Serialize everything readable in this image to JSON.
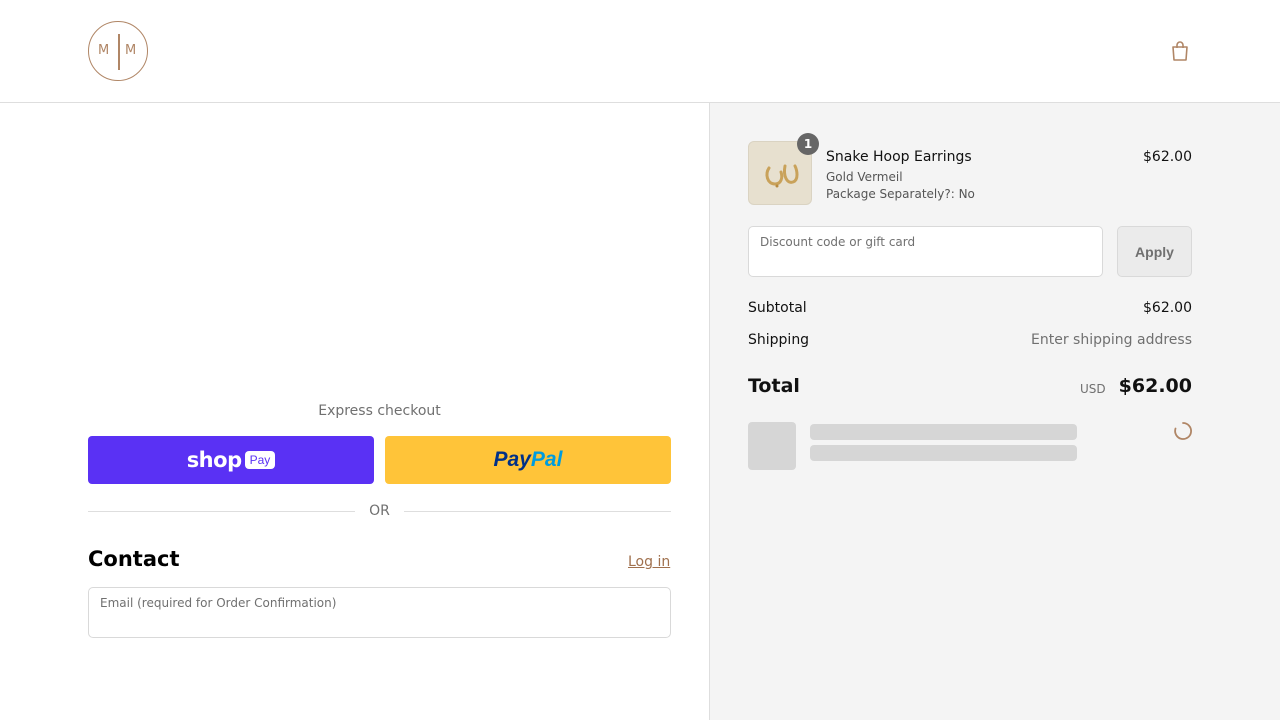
{
  "header": {
    "logo_letters": [
      "M",
      "M"
    ],
    "cart_icon": "shopping-bag-icon",
    "accent": "#b08666"
  },
  "checkout": {
    "express_title": "Express checkout",
    "shop_pay": {
      "word": "shop",
      "badge": "Pay",
      "color": "#5a31f4"
    },
    "paypal": {
      "part1": "Pay",
      "part2": "Pal",
      "color": "#ffc439"
    },
    "divider": "OR",
    "contact": {
      "title": "Contact",
      "login": "Log in",
      "email_placeholder": "Email (required for Order Confirmation)"
    }
  },
  "summary": {
    "item": {
      "quantity": "1",
      "name": "Snake Hoop Earrings",
      "variant": "Gold Vermeil",
      "option": "Package Separately?: No",
      "price": "$62.00"
    },
    "discount": {
      "placeholder": "Discount code or gift card",
      "apply": "Apply"
    },
    "subtotal": {
      "label": "Subtotal",
      "value": "$62.00"
    },
    "shipping": {
      "label": "Shipping",
      "value": "Enter shipping address"
    },
    "total": {
      "label": "Total",
      "currency": "USD",
      "value": "$62.00"
    }
  }
}
